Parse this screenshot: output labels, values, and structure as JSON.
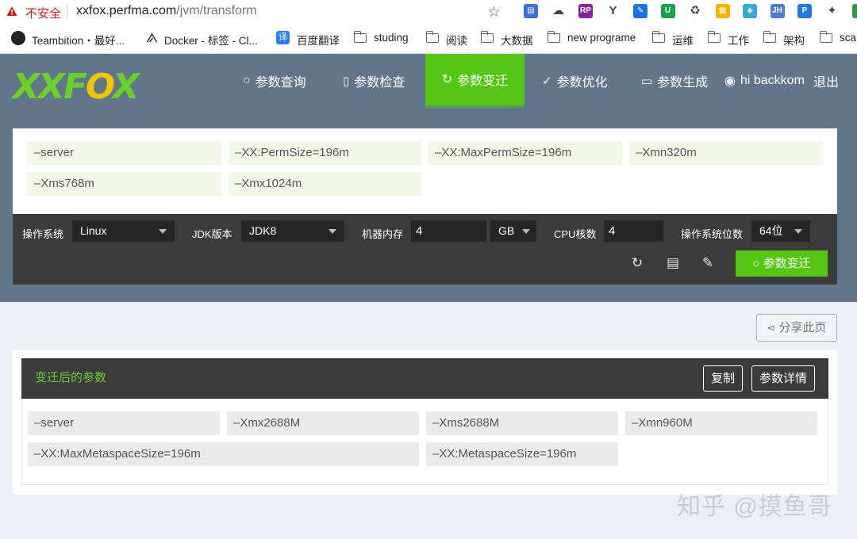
{
  "browser": {
    "insecure_label": "不安全",
    "url_host": "xxfox.perfma.com",
    "url_path": "/jvm/transform",
    "extensions": [
      {
        "icon": "calendar-ext-icon",
        "color": "#3a6fd8",
        "text": "▤"
      },
      {
        "icon": "cloud-ext-icon",
        "color": "#ffffff",
        "text": "☁"
      },
      {
        "icon": "rp-ext-icon",
        "color": "#8b1fa8",
        "text": "RP"
      },
      {
        "icon": "y-ext-icon",
        "color": "#ffffff",
        "text": "Y"
      },
      {
        "icon": "pen-ext-icon",
        "color": "#1a73e8",
        "text": "✎"
      },
      {
        "icon": "shield-ext-icon",
        "color": "#16a34a",
        "text": "U"
      },
      {
        "icon": "recycle-ext-icon",
        "color": "#ffffff",
        "text": "♻"
      },
      {
        "icon": "note-ext-icon",
        "color": "#f5b400",
        "text": "▦"
      },
      {
        "icon": "screen-ext-icon",
        "color": "#37a6d8",
        "text": "◈"
      },
      {
        "icon": "jh-ext-icon",
        "color": "#4a7bd0",
        "text": "JH"
      },
      {
        "icon": "p-ext-icon",
        "color": "#2477e6",
        "text": "P"
      },
      {
        "icon": "fox-ext-icon",
        "color": "#ffffff",
        "text": "✦"
      },
      {
        "icon": "v-ext-icon",
        "color": "#2e9b3e",
        "text": "V"
      }
    ]
  },
  "bookmarks": [
    {
      "label": "Teambition・最好...",
      "icon": "teambition-icon"
    },
    {
      "label": "Docker - 标签 - Cl...",
      "icon": "docker-icon"
    },
    {
      "label": "百度翻译",
      "icon": "baidu-translate-icon"
    },
    {
      "label": "studing",
      "icon": "folder-icon"
    },
    {
      "label": "阅读",
      "icon": "folder-icon"
    },
    {
      "label": "大数据",
      "icon": "folder-icon"
    },
    {
      "label": "new programe",
      "icon": "folder-icon"
    },
    {
      "label": "运维",
      "icon": "folder-icon"
    },
    {
      "label": "工作",
      "icon": "folder-icon"
    },
    {
      "label": "架构",
      "icon": "folder-icon"
    },
    {
      "label": "sca",
      "icon": "folder-icon"
    }
  ],
  "site": {
    "logo_text": "XXFOX",
    "nav": [
      {
        "label": "参数查询",
        "icon": "search-icon"
      },
      {
        "label": "参数检查",
        "icon": "doc-search-icon"
      },
      {
        "label": "参数变迁",
        "icon": "refresh-icon",
        "active": true
      },
      {
        "label": "参数优化",
        "icon": "check-circle-icon"
      },
      {
        "label": "参数生成",
        "icon": "monitor-icon"
      }
    ],
    "user_greeting": "hi backkom",
    "logout_label": "退出",
    "accent_color": "#56c614"
  },
  "input_params": [
    "–server",
    "–XX:PermSize=196m",
    "–XX:MaxPermSize=196m",
    "–Xmn320m",
    "–Xms768m",
    "–Xmx1024m"
  ],
  "options": {
    "os_label": "操作系统",
    "os_value": "Linux",
    "jdk_label": "JDK版本",
    "jdk_value": "JDK8",
    "memory_label": "机器内存",
    "memory_value": "4",
    "memory_unit": "GB",
    "cpu_label": "CPU核数",
    "cpu_value": "4",
    "arch_label": "操作系统位数",
    "arch_value": "64位",
    "transform_button": "参数变迁"
  },
  "share_label": "分享此页",
  "result": {
    "title": "变迁后的参数",
    "copy_label": "复制",
    "detail_label": "参数详情",
    "params": [
      "–server",
      "–Xmx2688M",
      "–Xms2688M",
      "–Xmn960M",
      "–XX:MaxMetaspaceSize=196m",
      "–XX:MetaspaceSize=196m"
    ]
  },
  "watermark": "知乎 @摸鱼哥"
}
